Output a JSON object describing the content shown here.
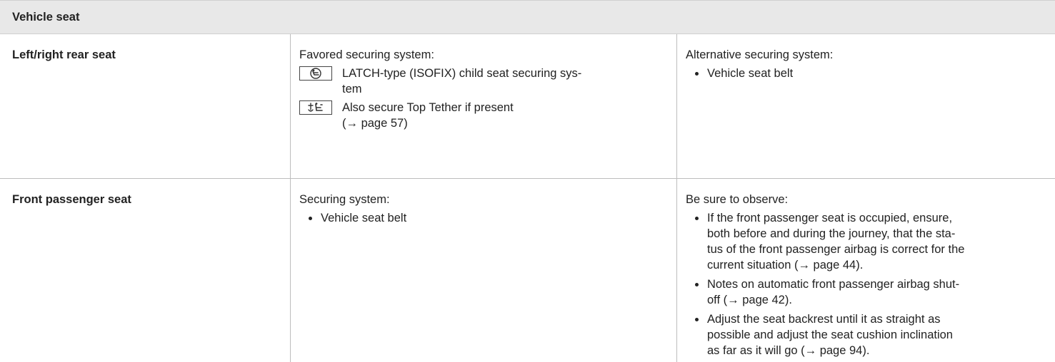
{
  "header": {
    "title": "Vehicle seat"
  },
  "rows": [
    {
      "seat": "Left/right rear seat",
      "col2_heading": "Favored securing system:",
      "col2_items": [
        {
          "icon": "isofix-seat-icon",
          "lines": [
            "LATCH-type (ISOFIX) child seat securing sys-",
            "tem"
          ]
        },
        {
          "icon": "top-tether-icon",
          "lines": [
            "Also secure Top Tether if present",
            "(→ page 57)"
          ]
        }
      ],
      "col3_heading": "Alternative securing system:",
      "col3_bullets": [
        {
          "lines": [
            "Vehicle seat belt"
          ]
        }
      ]
    },
    {
      "seat": "Front passenger seat",
      "col2_heading": "Securing system:",
      "col2_bullets": [
        {
          "lines": [
            "Vehicle seat belt"
          ]
        }
      ],
      "col3_heading": "Be sure to observe:",
      "col3_bullets": [
        {
          "lines": [
            "If the front passenger seat is occupied, ensure,",
            "both before and during the journey, that the sta-",
            "tus of the front passenger airbag is correct for the",
            "current situation (→ page 44)."
          ]
        },
        {
          "lines": [
            "Notes on automatic front passenger airbag shut-",
            "off (→ page 42)."
          ]
        },
        {
          "lines": [
            "Adjust the seat backrest until it as straight as",
            "possible and adjust the seat cushion inclination",
            "as far as it will go (→ page 94)."
          ]
        }
      ]
    }
  ]
}
